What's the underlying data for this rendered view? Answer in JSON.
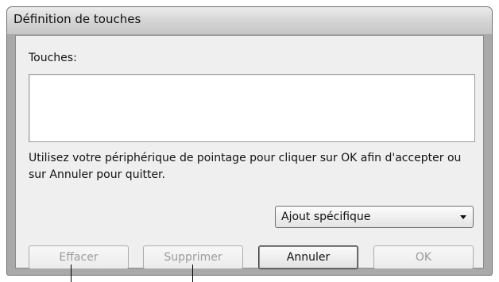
{
  "window": {
    "title": "Définition de touches"
  },
  "keys": {
    "label": "Touches:",
    "value": ""
  },
  "help_text": "Utilisez votre périphérique de pointage pour cliquer sur OK afin d'accepter ou sur Annuler pour quitter.",
  "dropdown": {
    "selected": "Ajout spécifique"
  },
  "buttons": {
    "clear": "Effacer",
    "delete": "Supprimer",
    "cancel": "Annuler",
    "ok": "OK"
  }
}
